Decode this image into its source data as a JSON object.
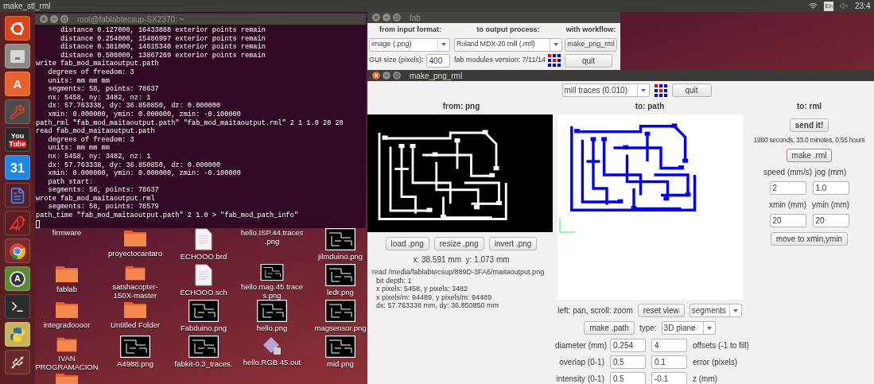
{
  "top_bar": {
    "window_title": "make_stl_rml",
    "keyboard_layout": "En",
    "clock": "23:4"
  },
  "launcher": {
    "software_center_glyph": "A",
    "youtube_logo": [
      "You",
      "Tube"
    ],
    "calendar_day": "31",
    "updater_glyph": "A"
  },
  "terminal": {
    "title": "root@fablabtecsup-SX2370: ~",
    "active": false,
    "lines": [
      "      distance 0.127000, 16433888 exterior points remain",
      "      distance 0.254000, 15486997 exterior points remain",
      "      distance 0.381000, 14615340 exterior points remain",
      "      distance 0.508000, 13867269 exterior points remain",
      "write fab_mod_maitaoutput.path",
      "   degrees of freedom: 3",
      "   units: mm mm mm",
      "   segments: 58, points: 78637",
      "   nx: 5458, ny: 3482, nz: 1",
      "   dx: 57.763338, dy: 36.850850, dz: 0.000000",
      "   xmin: 0.000000, ymin: 0.000000, zmin: -0.100000",
      "path_rml \"fab_mod_maitaoutput.path\" \"fab_mod_maitaoutput.rml\" 2 1 1.0 20 20",
      "read fab_mod_maitaoutput.path",
      "   degrees of freedom: 3",
      "   units: mm mm mm",
      "   nx: 5458, ny: 3482, nz: 1",
      "   dx: 57.763338, dy: 36.850850, dz: 0.000000",
      "   xmin: 0.000000, ymin: 0.000000, zmin: -0.100000",
      "   path start:",
      "   segments: 58, points: 78637",
      "wrote fab_mod_maitaoutput.rml",
      "   segments: 58, points: 78579",
      "path_time \"fab_mod_maitaoutput.path\" 2 1.0 > \"fab_mod_path_info\""
    ]
  },
  "desktop_columns": [
    [
      {
        "kind": "label",
        "label": "firmware"
      },
      {
        "kind": "folder",
        "label": "fablab"
      },
      {
        "kind": "folder",
        "label": "integradoooor"
      },
      {
        "kind": "folder",
        "label": "IVAN PROGRAMACION"
      },
      {
        "kind": "folder"
      }
    ],
    [
      {
        "kind": "folder",
        "label": "proyectocantaro"
      },
      {
        "kind": "folder",
        "label": "satshacopter-150X-master"
      },
      {
        "kind": "folder",
        "label": "Untitled Folder"
      },
      {
        "kind": "image",
        "label": "A4988.png"
      }
    ],
    [
      {
        "kind": "document",
        "label": "ECHOOO.brd"
      },
      {
        "kind": "document",
        "label": "ECHOOO.sch"
      },
      {
        "kind": "image",
        "label": "Fabduino.png"
      },
      {
        "kind": "image",
        "label": "fabkit-0.3_traces."
      }
    ],
    [
      {
        "kind": "label",
        "label": "hello.ISP.44.traces.png"
      },
      {
        "kind": "image",
        "label": "hello.mag.45.traces.png"
      },
      {
        "kind": "image",
        "label": "hello.png"
      },
      {
        "kind": "archive",
        "label": "hello.RGB.45.out"
      }
    ],
    [
      {
        "kind": "image",
        "label": "jilmduino.png"
      },
      {
        "kind": "image",
        "label": "ledr.png"
      },
      {
        "kind": "image",
        "label": "magsensor.png"
      },
      {
        "kind": "image",
        "label": "mid.png"
      }
    ]
  ],
  "fab_window": {
    "title": "fab",
    "active": false,
    "headers": [
      "from input format:",
      "to output process:",
      "with workflow:"
    ],
    "input_format": "image (.png)",
    "output_process": "Roland MDX-20 mill (.rml)",
    "workflow_button": "make_png_rml",
    "gui_size_label": "GUI size (pixels):",
    "gui_size": "400",
    "version": "fab modules version: 7/11/14",
    "quit_button": "quit"
  },
  "make_window": {
    "title": "make_png_rml",
    "active": true,
    "process": "mill traces (0.010)",
    "quit_button": "quit",
    "columns": [
      "from: png",
      "to: path",
      "to: rml"
    ],
    "png": {
      "buttons": [
        "load .png",
        "resize .png",
        "invert .png"
      ],
      "cursor": "x: 38.591 mm  y: 1.073 mm",
      "info": [
        "read /media/fablabtecsup/889D-3FA6/maitaoutput.png",
        "bit depth: 1",
        "x pixels: 5458, y pixels: 3482",
        "x pixels/m: 94489, y pixels/m: 94489",
        "dx: 57.763338 mm, dy: 36.850850 mm"
      ]
    },
    "path": {
      "hint": "left: pan, scroll: zoom",
      "reset_button": "reset view",
      "view_mode": "segments",
      "make_button": "make .path",
      "type_label": "type:",
      "type": "3D plane",
      "params": [
        {
          "label": "diameter (mm)",
          "value": "0.254",
          "value_2": "4",
          "label_2": "offsets (-1 to fill)"
        },
        {
          "label": "overlap (0-1)",
          "value": "0.5",
          "value_2": "0.1",
          "label_2": "error (pixels)"
        },
        {
          "label": "intensity (0-1)",
          "value": "0.5",
          "value_2": "-0.1",
          "label_2": "z (mm)"
        }
      ]
    },
    "rml": {
      "send_button": "send it!",
      "estimate": "1980 seconds, 33.0 minutes, 0.55 hours",
      "make_button": {
        "label": "make .rml",
        "focused": true
      },
      "field_rows": [
        [
          {
            "label": "speed (mm/s)",
            "value": "2"
          },
          {
            "label": "jog (mm)",
            "value": "1.0"
          }
        ],
        [
          {
            "label": "xmin (mm)",
            "value": "20"
          },
          {
            "label": "ymin (mm)",
            "value": "20"
          }
        ]
      ],
      "move_button": "move to xmin,ymin"
    }
  }
}
